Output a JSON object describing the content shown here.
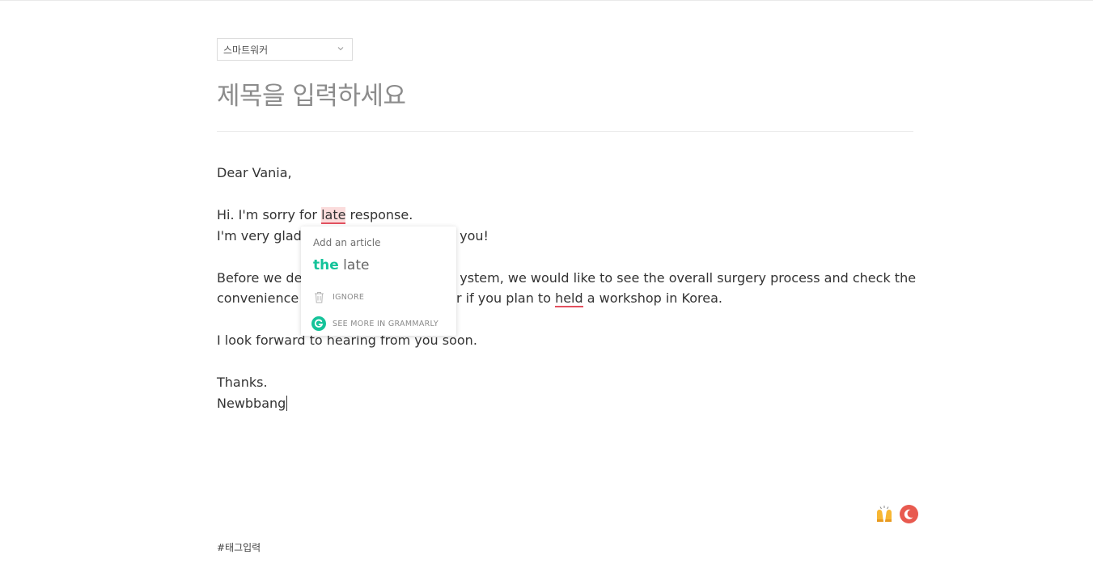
{
  "editor": {
    "category": "스마트워커",
    "title_placeholder": "제목을 입력하세요",
    "tag_placeholder": "#태그입력"
  },
  "letter": {
    "greeting": "Dear Vania,",
    "line2_a": "Hi. I'm sorry for ",
    "line2_flag": "late",
    "line2_b": " response.",
    "line3_a": "I'm very glad t",
    "line3_b": "you!",
    "line4_a": "Before we dec",
    "line4_b": "ystem, we would like to see the overall surgery process and check the",
    "line5_a": "convenience o",
    "line5_b": "er if you plan to ",
    "line5_flag": "held",
    "line5_c": " a workshop in Korea.",
    "line6": "I look forward to hearing from you soon.",
    "thanks": "Thanks.",
    "signature": "Newbbang"
  },
  "grammarly_popup": {
    "heading": "Add an article",
    "insert": "the",
    "original": "late",
    "ignore_label": "IGNORE",
    "more_label": "SEE MORE IN GRAMMARLY",
    "brand_color": "#15c39a",
    "error_color": "#e3505f"
  },
  "footer_icons": [
    "raising-hands-emoji-icon",
    "night-mode-icon"
  ]
}
